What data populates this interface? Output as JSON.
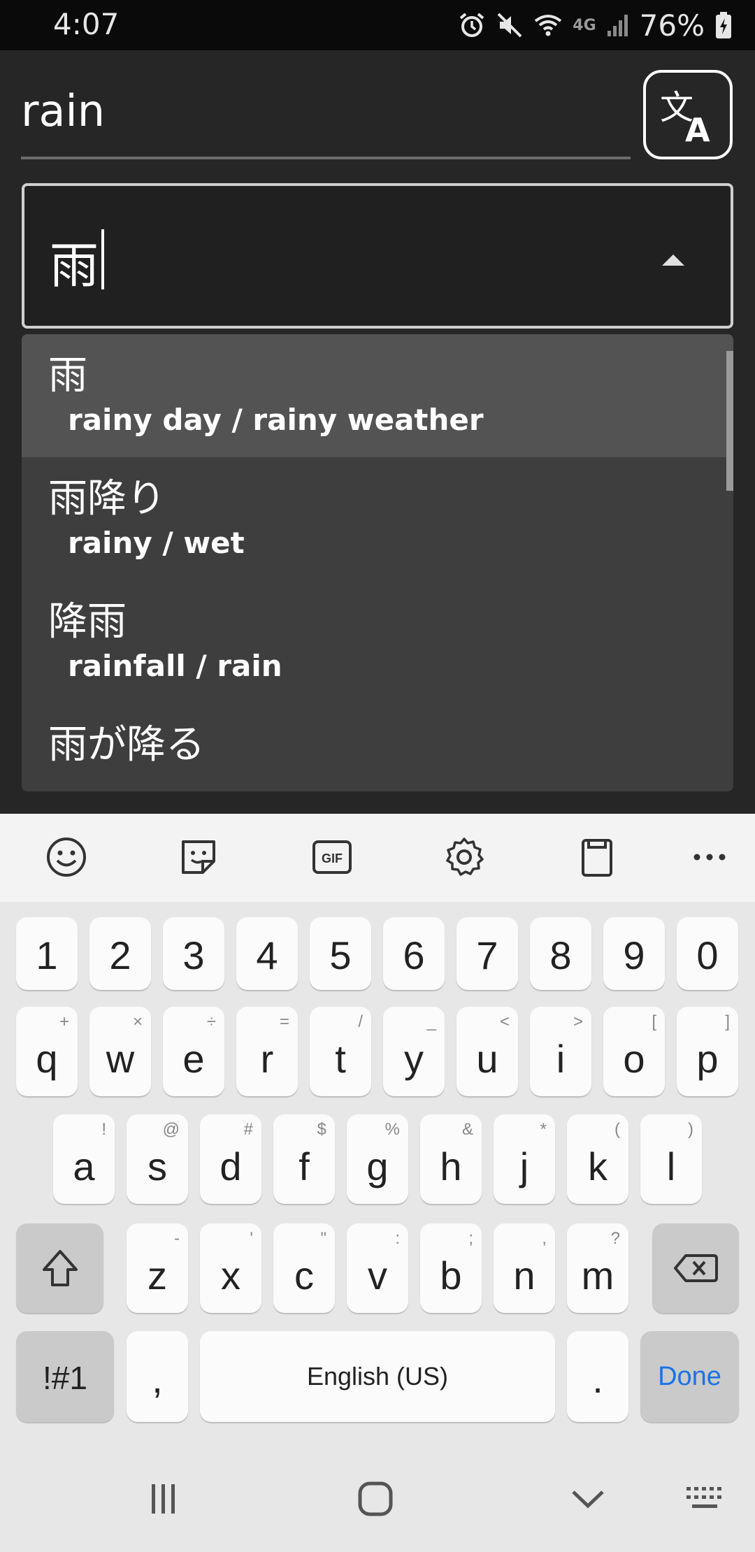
{
  "status_bar": {
    "time": "4:07",
    "battery_percent": "76%",
    "network_label": "4G",
    "icons": [
      "alarm-icon",
      "mute-icon",
      "wifi-icon",
      "network-4g-icon",
      "signal-icon",
      "battery-charging-icon"
    ]
  },
  "search": {
    "query": "rain",
    "translate_icon": "translate-icon"
  },
  "select": {
    "value": "雨"
  },
  "suggestions": [
    {
      "word": "雨",
      "meaning": "rainy day / rainy weather",
      "selected": true
    },
    {
      "word": "雨降り",
      "meaning": "rainy / wet",
      "selected": false
    },
    {
      "word": "降雨",
      "meaning": "rainfall / rain",
      "selected": false
    },
    {
      "word": "雨が降る",
      "meaning": "",
      "selected": false
    }
  ],
  "keyboard": {
    "toolbar_icons": [
      "emoji-icon",
      "sticker-icon",
      "gif-icon",
      "settings-icon",
      "clipboard-icon",
      "more-icon"
    ],
    "gif_label": "GIF",
    "number_row": [
      "1",
      "2",
      "3",
      "4",
      "5",
      "6",
      "7",
      "8",
      "9",
      "0"
    ],
    "row1": [
      {
        "k": "q",
        "h": "+"
      },
      {
        "k": "w",
        "h": "×"
      },
      {
        "k": "e",
        "h": "÷"
      },
      {
        "k": "r",
        "h": "="
      },
      {
        "k": "t",
        "h": "/"
      },
      {
        "k": "y",
        "h": "_"
      },
      {
        "k": "u",
        "h": "<"
      },
      {
        "k": "i",
        "h": ">"
      },
      {
        "k": "o",
        "h": "["
      },
      {
        "k": "p",
        "h": "]"
      }
    ],
    "row2": [
      {
        "k": "a",
        "h": "!"
      },
      {
        "k": "s",
        "h": "@"
      },
      {
        "k": "d",
        "h": "#"
      },
      {
        "k": "f",
        "h": "$"
      },
      {
        "k": "g",
        "h": "%"
      },
      {
        "k": "h",
        "h": "&"
      },
      {
        "k": "j",
        "h": "*"
      },
      {
        "k": "k",
        "h": "("
      },
      {
        "k": "l",
        "h": ")"
      }
    ],
    "row3": [
      {
        "k": "z",
        "h": "-"
      },
      {
        "k": "x",
        "h": "'"
      },
      {
        "k": "c",
        "h": "\""
      },
      {
        "k": "v",
        "h": ":"
      },
      {
        "k": "b",
        "h": ";"
      },
      {
        "k": "n",
        "h": ","
      },
      {
        "k": "m",
        "h": "?"
      }
    ],
    "symbols_label": "!#1",
    "comma": ",",
    "space_label": "English (US)",
    "period": ".",
    "done_label": "Done",
    "done_color": "#1a73e8"
  },
  "nav_bar": {
    "icons": [
      "recent-apps-icon",
      "home-icon",
      "back-icon",
      "keyboard-switch-icon"
    ]
  }
}
